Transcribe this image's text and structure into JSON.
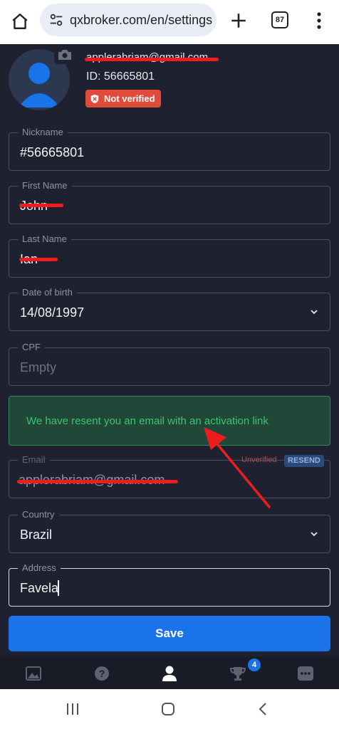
{
  "browser": {
    "url": "qxbroker.com/en/settings",
    "tab_count": "87"
  },
  "profile": {
    "email": "applerabriam@gmail.com",
    "user_id": "ID: 56665801",
    "status_badge": "Not verified"
  },
  "fields": {
    "nickname": {
      "label": "Nickname",
      "value": "#56665801"
    },
    "first_name": {
      "label": "First Name",
      "value": "John"
    },
    "last_name": {
      "label": "Last Name",
      "value": "Ian"
    },
    "dob": {
      "label": "Date of birth",
      "value": "14/08/1997"
    },
    "cpf": {
      "label": "CPF",
      "placeholder": "Empty"
    },
    "email": {
      "label": "Email",
      "value": "applerabriam@gmail.com",
      "status": "Unverified",
      "resend_label": "RESEND"
    },
    "country": {
      "label": "Country",
      "value": "Brazil"
    },
    "address": {
      "label": "Address",
      "value": "Favela"
    }
  },
  "notice": {
    "message": "We have resent you an email with an activation link"
  },
  "save_label": "Save",
  "bottom_nav": {
    "items": [
      "chart-icon",
      "help-icon",
      "profile-icon",
      "trophy-icon",
      "chat-icon"
    ],
    "trophy_badge": "4",
    "active": "profile-icon"
  },
  "colors": {
    "background": "#1e2230",
    "accent": "#1a73e8",
    "success": "#3ec46f",
    "danger": "#e04b3b",
    "redaction": "#ee1c1c"
  }
}
